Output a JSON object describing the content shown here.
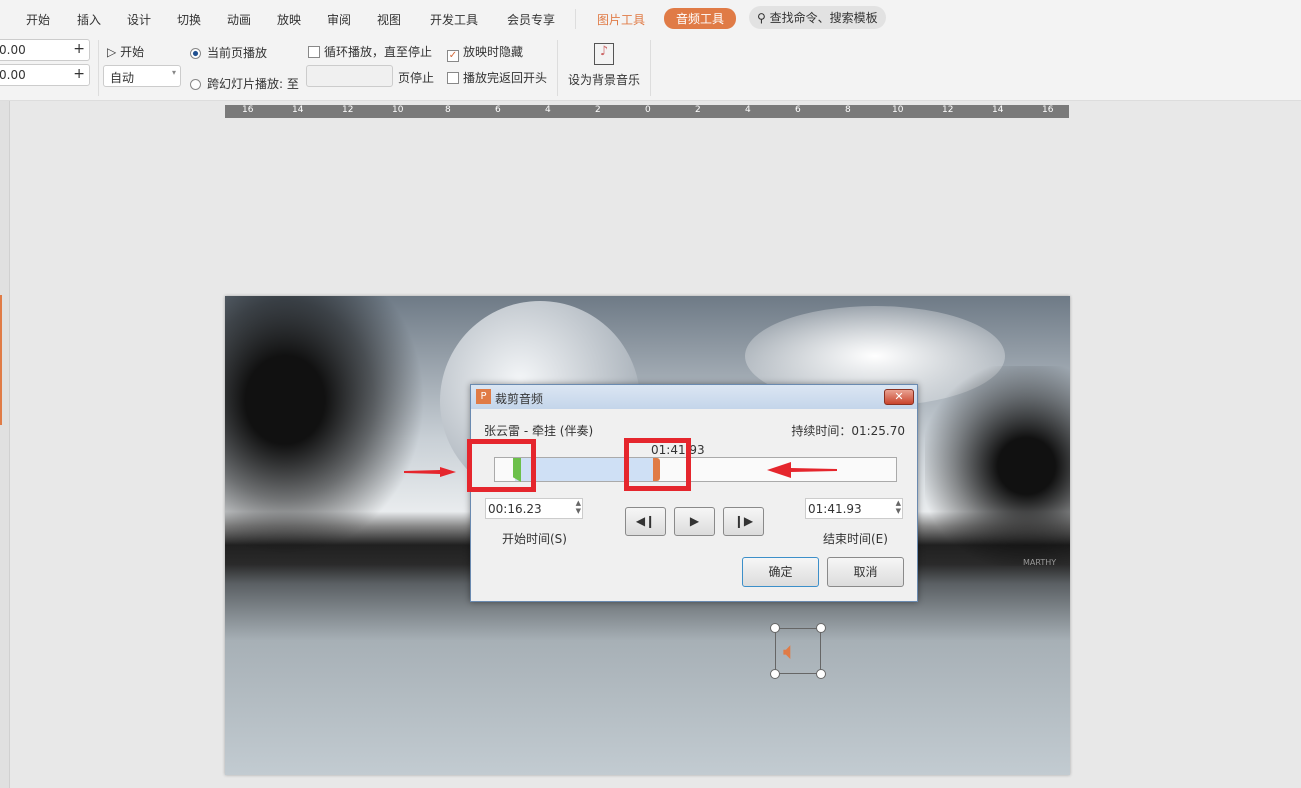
{
  "menu": [
    "开始",
    "插入",
    "设计",
    "切换",
    "动画",
    "放映",
    "审阅",
    "视图",
    "开发工具",
    "会员专享"
  ],
  "context_tabs": {
    "picture_tools": "图片工具",
    "audio_tools": "音频工具"
  },
  "search_placeholder": "查找命令、搜索模板",
  "ribbon": {
    "fade_in": "0.00",
    "fade_out": "0.00",
    "start_label": "开始",
    "start_value": "自动",
    "current_page_play": "当前页播放",
    "cross_slide_play": "跨幻灯片播放: 至",
    "page_stop": "页停止",
    "loop_until_stop": "循环播放，直至停止",
    "hide_while_playing": "放映时隐藏",
    "rewind_after_play": "播放完返回开头",
    "set_bg_music": "设为背景音乐"
  },
  "ruler_labels": [
    "16",
    "14",
    "12",
    "10",
    "8",
    "6",
    "4",
    "2",
    "0",
    "2",
    "4",
    "6",
    "8",
    "10",
    "12",
    "14",
    "16"
  ],
  "dialog": {
    "title": "裁剪音频",
    "track": "张云雷 - 牵挂 (伴奏)",
    "duration": "持续时间：01:25.70",
    "marker_time": "01:41.93",
    "start_time": "00:16.23",
    "start_label": "开始时间(S)",
    "end_time": "01:41.93",
    "end_label": "结束时间(E)",
    "ok": "确定",
    "cancel": "取消"
  },
  "watermark": "MARTHY",
  "colors": {
    "accent": "#e07b46",
    "selection": "#cfe0f5",
    "start_marker": "#6cc04a",
    "end_marker": "#e07b46",
    "annotation": "#e5262d"
  }
}
